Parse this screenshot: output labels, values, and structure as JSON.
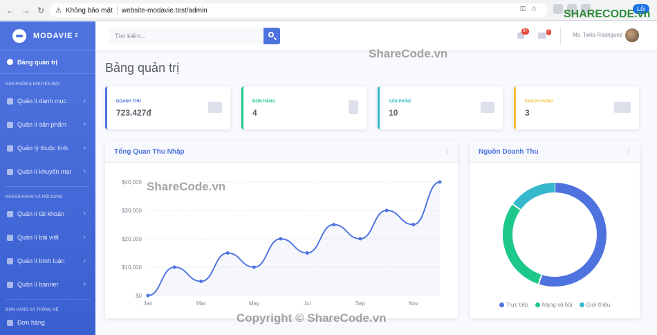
{
  "browser": {
    "security_label": "Không bảo mật",
    "url": "website-modavie.test/admin",
    "error_label": "Lỗi"
  },
  "sidebar": {
    "brand": "MODAVIE",
    "brand_sup": "2",
    "active_item": "Bảng quản trị",
    "sections": [
      {
        "heading": "SẢN PHẨM & KHUYẾN MẠI",
        "items": [
          "Quản lí danh mục",
          "Quản lí sản phẩm",
          "Quản lý thuộc tính",
          "Quản lí khuyến mại"
        ]
      },
      {
        "heading": "KHÁCH HÀNG VÀ NỘI DUNG",
        "items": [
          "Quản lí tài khoản",
          "Quản lí bài viết",
          "Quản lí bình luận",
          "Quản lí banner"
        ]
      },
      {
        "heading": "ĐƠN HÀNG VÀ THỐNG KÊ",
        "items": [
          "Đơn hàng"
        ]
      }
    ]
  },
  "topbar": {
    "search_placeholder": "Tìm kiếm...",
    "alerts_count": "3+",
    "messages_count": "7",
    "user_name": "Ms. Twila Rodriguez"
  },
  "page": {
    "title": "Bảng quản trị"
  },
  "cards": [
    {
      "label": "DOANH THU",
      "value": "723.427đ",
      "color": "#4e73df",
      "icon": "money-icon"
    },
    {
      "label": "ĐƠN HÀNG",
      "value": "4",
      "color": "#1cc88a",
      "icon": "clipboard-icon"
    },
    {
      "label": "SẢN PHẨM",
      "value": "10",
      "color": "#36b9cc",
      "icon": "store-icon"
    },
    {
      "label": "KHÁCH HÀNG",
      "value": "3",
      "color": "#f6c23e",
      "icon": "users-icon"
    }
  ],
  "area_panel": {
    "title": "Tổng Quan Thu Nhập"
  },
  "pie_panel": {
    "title": "Nguồn Doanh Thu"
  },
  "watermarks": [
    "ShareCode.vn",
    "ShareCode.vn",
    "Copyright © ShareCode.vn",
    "SHARECODE.vn"
  ],
  "chart_data": [
    {
      "type": "line",
      "x": [
        "Jan",
        "Feb",
        "Mar",
        "Apr",
        "May",
        "Jun",
        "Jul",
        "Aug",
        "Sep",
        "Oct",
        "Nov",
        "Dec"
      ],
      "tick_labels": [
        "Jan",
        "Mar",
        "May",
        "Jul",
        "Sep",
        "Nov"
      ],
      "series": [
        {
          "values": [
            0,
            10000,
            5000,
            15000,
            10000,
            20000,
            15000,
            25000,
            20000,
            30000,
            25000,
            40000
          ],
          "color": "#4e73df"
        }
      ],
      "y_ticks": [
        "$0",
        "$10,000",
        "$20,000",
        "$30,000",
        "$40,000"
      ],
      "ylim": [
        0,
        40000
      ],
      "grid": true
    },
    {
      "type": "pie",
      "donut": true,
      "labels": [
        "Trực tiếp",
        "Mạng xã hội",
        "Giới thiệu"
      ],
      "values": [
        55,
        30,
        15
      ],
      "colors": [
        "#4e73df",
        "#1cc88a",
        "#36b9cc"
      ],
      "legend_position": "bottom"
    }
  ]
}
